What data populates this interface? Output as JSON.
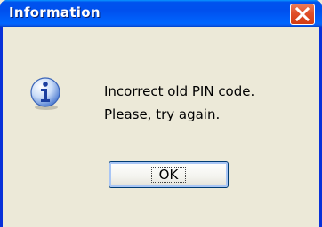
{
  "window": {
    "title": "Information",
    "close_icon": "close-icon"
  },
  "dialog": {
    "icon": "info-icon",
    "message_line1": "Incorrect old PIN code.",
    "message_line2": "Please, try again.",
    "ok_label": "OK"
  },
  "colors": {
    "titlebar": "#0050ee",
    "close_button": "#e0502a",
    "client_background": "#ece9d8",
    "button_focus": "#a9c6f5"
  }
}
